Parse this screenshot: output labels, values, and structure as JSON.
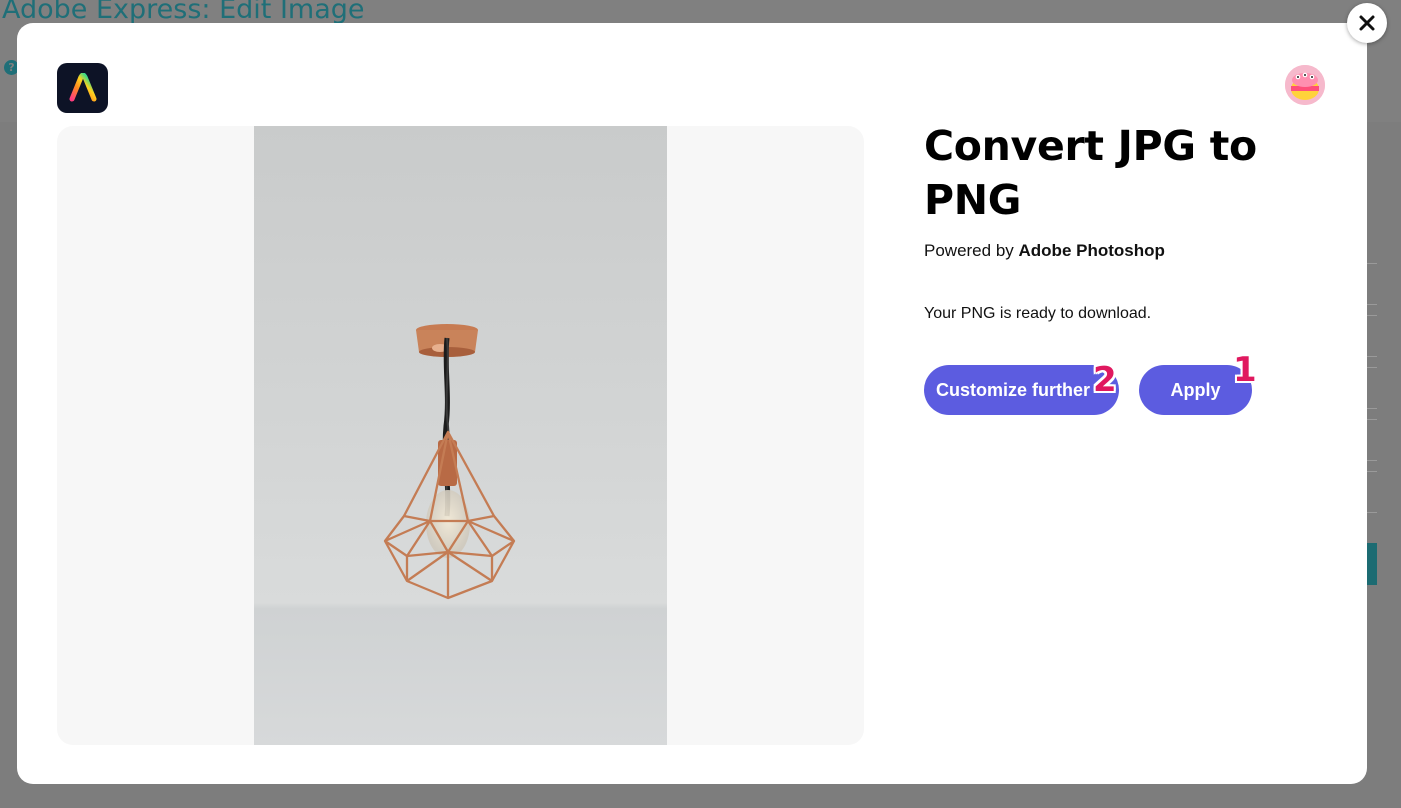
{
  "background": {
    "title": "Adobe Express: Edit Image",
    "help_icon": "question-circle-icon",
    "help_glyph": "?"
  },
  "modal": {
    "close_icon": "close-icon",
    "logo_icon": "adobe-express-logo-icon",
    "avatar_icon": "user-avatar-icon",
    "heading": "Convert JPG to PNG",
    "powered_prefix": "Powered by",
    "powered_brand": "Adobe Photoshop",
    "status_text": "Your PNG is ready to download.",
    "buttons": {
      "customize_label": "Customize further",
      "apply_label": "Apply"
    },
    "markers": {
      "apply_marker": "1",
      "customize_marker": "2"
    },
    "preview_image": "pendant-lamp-photo"
  },
  "colors": {
    "button": "#5c5ce0",
    "marker": "#e0185f",
    "background_title": "#1f6f78"
  }
}
